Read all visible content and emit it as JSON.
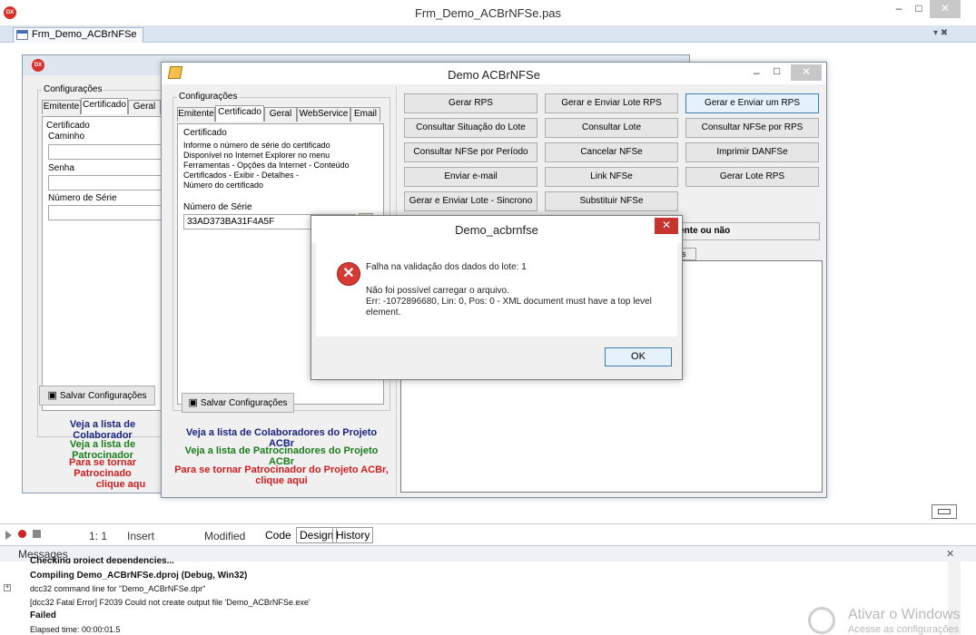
{
  "ide": {
    "title": "Frm_Demo_ACBrNFSe.pas",
    "logo": "DX",
    "controls": {
      "minimize": "–",
      "maximize": "□",
      "close": "✕"
    },
    "editor_tab": "Frm_Demo_ACBrNFSe",
    "tabbar_right": "▾ ✖"
  },
  "back_form": {
    "logo": "DX",
    "group_title": "Configurações",
    "tabs": [
      "Emitente",
      "Certificado",
      "Geral"
    ],
    "cert_group": "Certificado",
    "label_caminho": "Caminho",
    "label_senha": "Senha",
    "label_numero": "Número de Série",
    "save_button": "Salvar Configurações",
    "link_colab": "Veja a lista de Colaborador",
    "link_patroc": "Veja a lista de Patrocinador",
    "link_tornar_1": "Para se tornar Patrocinado",
    "link_tornar_2": "clique aqu"
  },
  "demo": {
    "title": "Demo ACBrNFSe",
    "config_title": "Configurações",
    "tabs": [
      "Emitente",
      "Certificado",
      "Geral",
      "WebService",
      "Email"
    ],
    "cert_group": "Certificado",
    "cert_info": [
      "Informe o número de série do certificado",
      "Disponível no Internet Explorer no menu",
      "Ferramentas - Opções da Internet - Conteúdo",
      "Certificados - Exibir - Detalhes -",
      "Número do certificado"
    ],
    "serial_label": "Número de Série",
    "serial_value": "33AD373BA31F4A5F",
    "save_button": "Salvar Configurações",
    "link_colab": "Veja a lista de Colaboradores do Projeto ACBr",
    "link_patroc": "Veja a lista de Patrocinadores do Projeto ACBr",
    "link_tornar_1": "Para se tornar Patrocinador do Projeto ACBr,",
    "link_tornar_2": "clique aqui",
    "buttons": {
      "gerar_rps": "Gerar RPS",
      "gerar_enviar_lote": "Gerar e Enviar Lote RPS",
      "gerar_enviar_um": "Gerar e Enviar um RPS",
      "consultar_situacao": "Consultar Situação do Lote",
      "consultar_lote": "Consultar Lote",
      "consultar_nfse_rps": "Consultar NFSe por RPS",
      "consultar_periodo": "Consultar NFSe por Período",
      "cancelar": "Cancelar NFSe",
      "imprimir": "Imprimir DANFSe",
      "enviar_email": "Enviar e-mail",
      "link_nfse": "Link NFSe",
      "gerar_lote": "Gerar Lote RPS",
      "enviar_sincrono": "Gerar e Enviar Lote - Sincrono",
      "substituir": "Substituir NFSe"
    },
    "partial_label": "nente ou não",
    "partial_tab": "os"
  },
  "dialog": {
    "title": "Demo_acbrnfse",
    "icon": "✕",
    "line1": "Falha na validação dos dados do lote: 1",
    "line2": "Não foi possível carregar o arquivo.",
    "line3": "Err: -1072896680, Lin: 0, Pos: 0 - XML document must have a top level",
    "line4": "element.",
    "ok": "OK"
  },
  "statusbar": {
    "position": "1:  1",
    "mode": "Insert",
    "modified": "Modified",
    "tabs": [
      "Code",
      "Design",
      "History"
    ]
  },
  "messages": {
    "title": "Messages",
    "lines": [
      "Checking project dependencies...",
      "Compiling Demo_ACBrNFSe.dproj (Debug, Win32)",
      "dcc32 command line for \"Demo_ACBrNFSe.dpr\"",
      "[dcc32 Fatal Error] F2039 Could not create output file 'Demo_ACBrNFSe.exe'",
      "Failed",
      "Elapsed time: 00:00:01.5"
    ],
    "watermark_1": "Ativar o Windows",
    "watermark_2": "Acesse as configurações"
  }
}
